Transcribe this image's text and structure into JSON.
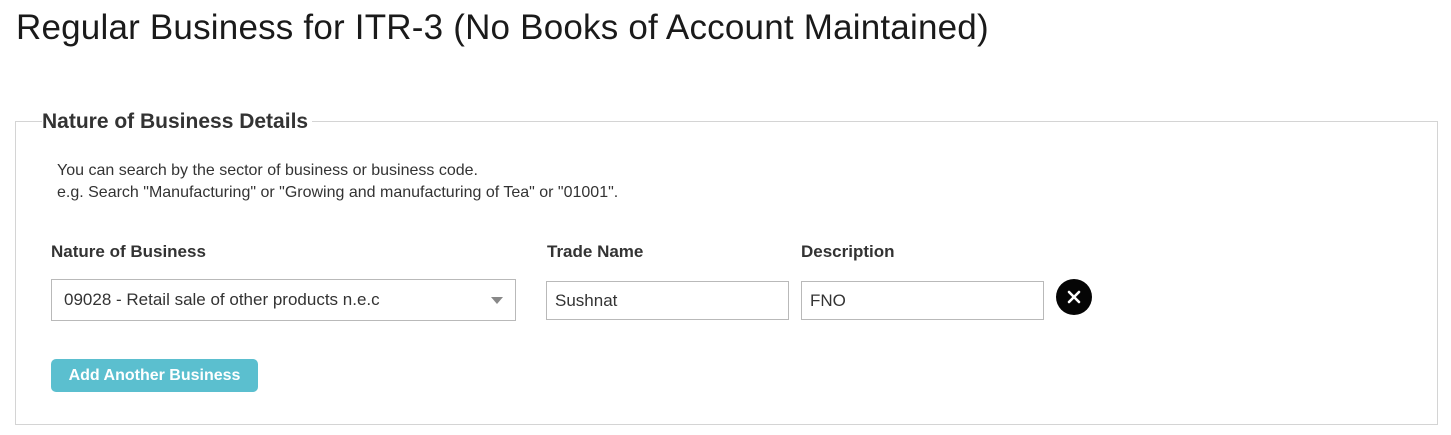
{
  "page": {
    "title": "Regular Business for ITR-3 (No Books of Account Maintained)"
  },
  "panel": {
    "legend": "Nature of Business Details",
    "hint_line1": "You can search by the sector of business or business code.",
    "hint_line2": "e.g. Search \"Manufacturing\" or \"Growing and manufacturing of Tea\" or \"01001\"."
  },
  "form": {
    "nature_label": "Nature of Business",
    "trade_label": "Trade Name",
    "description_label": "Description",
    "nature_value": "09028 - Retail sale of other products n.e.c",
    "trade_value": "Sushnat",
    "description_value": "FNO",
    "remove_icon": "close-icon",
    "add_label": "Add Another Business"
  },
  "colors": {
    "accent": "#5bbfcf",
    "remove_bg": "#050505",
    "border": "#d4d4d4"
  }
}
